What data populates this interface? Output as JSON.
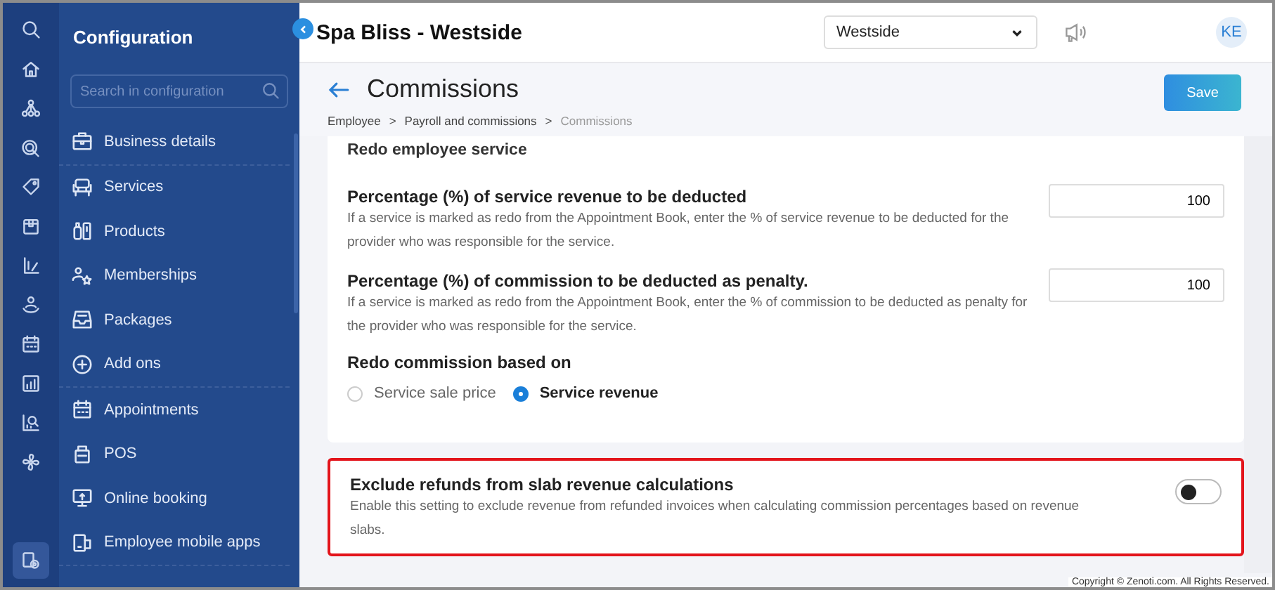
{
  "rail": {
    "items": [
      {
        "selected": false
      },
      {
        "selected": false
      },
      {
        "selected": false
      },
      {
        "selected": false
      },
      {
        "selected": false
      },
      {
        "selected": false
      },
      {
        "selected": false
      },
      {
        "selected": false
      },
      {
        "selected": false
      },
      {
        "selected": false
      },
      {
        "selected": false
      },
      {
        "selected": false
      },
      {
        "selected": true
      }
    ]
  },
  "config": {
    "title": "Configuration",
    "search": {
      "placeholder": "Search in configuration"
    },
    "items": [
      {
        "label": "Business details",
        "divider_after": true
      },
      {
        "label": "Services",
        "divider_after": false
      },
      {
        "label": "Products",
        "divider_after": false
      },
      {
        "label": "Memberships",
        "divider_after": false
      },
      {
        "label": "Packages",
        "divider_after": false
      },
      {
        "label": "Add ons",
        "divider_after": true
      },
      {
        "label": "Appointments",
        "divider_after": false
      },
      {
        "label": "POS",
        "divider_after": false
      },
      {
        "label": "Online booking",
        "divider_after": false
      },
      {
        "label": "Employee mobile apps",
        "divider_after": true
      }
    ]
  },
  "header": {
    "title": "Spa Bliss - Westside",
    "location": {
      "value": "Westside"
    },
    "avatar": "KE"
  },
  "page": {
    "title": "Commissions",
    "breadcrumbs": [
      {
        "label": "Employee",
        "current": false
      },
      {
        "label": "Payroll and commissions",
        "current": false
      },
      {
        "label": "Commissions",
        "current": true
      }
    ],
    "separators": [
      ">",
      ">"
    ],
    "save": "Save"
  },
  "redo": {
    "heading": "Redo employee service",
    "settings": [
      {
        "kind": "number",
        "label": "Percentage (%) of service revenue to be deducted",
        "description": "If a service is marked as redo from the Appointment Book, enter the % of service revenue to be deducted for the provider who was responsible for the service.",
        "value": "100"
      },
      {
        "kind": "number",
        "label": "Percentage (%) of commission to be deducted as penalty.",
        "description": "If a service is marked as redo from the Appointment Book, enter the % of commission to be deducted as penalty for the provider who was responsible for the service.",
        "value": "100"
      },
      {
        "kind": "radio",
        "label": "Redo commission based on",
        "options": [
          {
            "label": "Service sale price",
            "selected": false
          },
          {
            "label": "Service revenue",
            "selected": true
          }
        ]
      }
    ]
  },
  "refunds": {
    "label": "Exclude refunds from slab revenue calculations",
    "description": "Enable this setting to exclude revenue from refunded invoices when calculating commission percentages based on revenue slabs.",
    "on": false,
    "highlighted": true
  },
  "footer": "Copyright © Zenoti.com. All Rights Reserved."
}
